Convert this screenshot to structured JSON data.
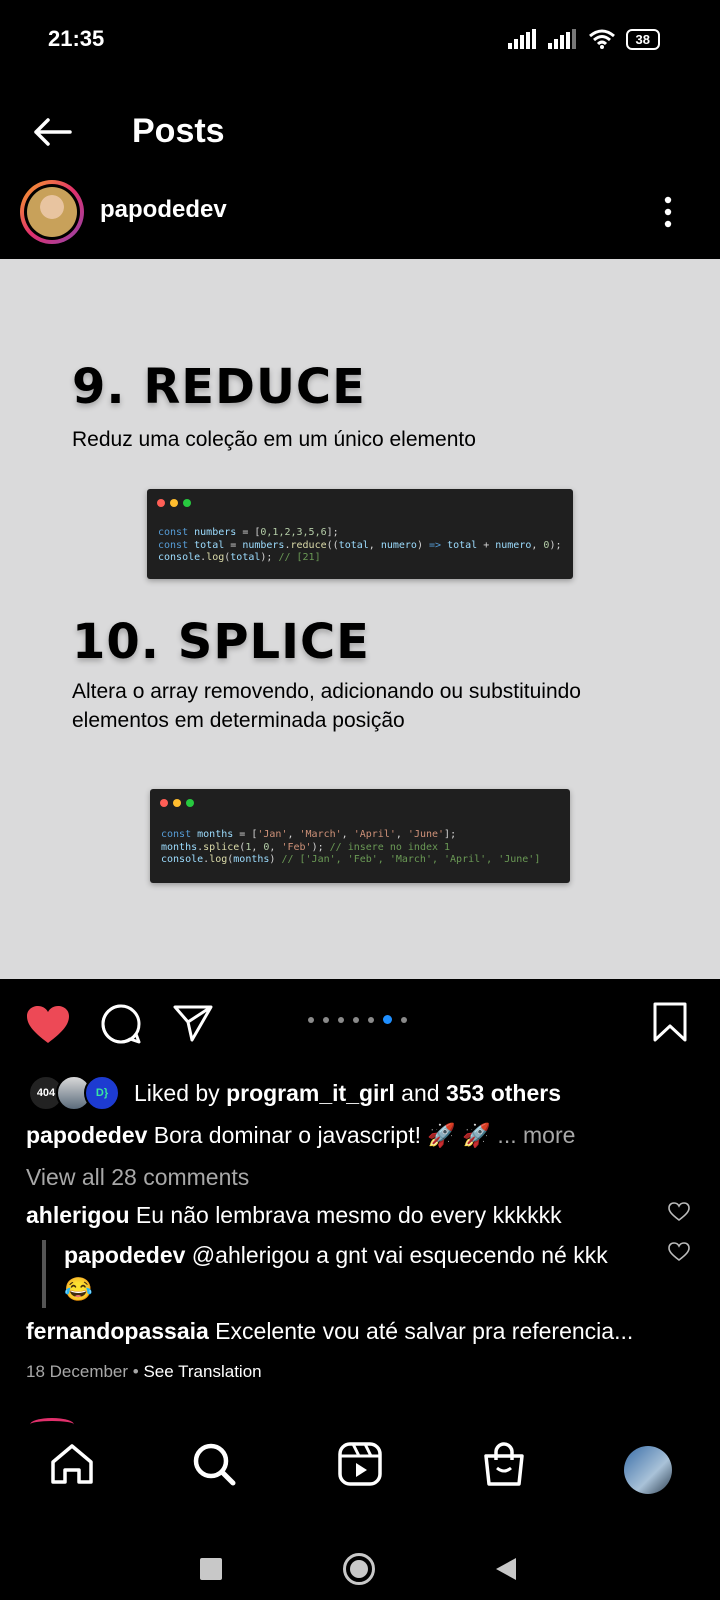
{
  "status_bar": {
    "time": "21:35",
    "battery": "38"
  },
  "header": {
    "title": "Posts"
  },
  "post": {
    "username": "papodedev",
    "slide": {
      "section1_title": "9. REDUCE",
      "section1_desc": "Reduz uma  coleção em um único elemento",
      "code1": [
        "const numbers = [0,1,2,3,5,6];",
        "const total = numbers.reduce((total, numero) => total + numero, 0);",
        "console.log(total); // [21]"
      ],
      "section2_title": "10. SPLICE",
      "section2_desc": "Altera o array removendo, adicionando ou substituindo elementos em determinada posição",
      "code2": [
        "const months = ['Jan', 'March', 'April', 'June'];",
        "months.splice(1, 0, 'Feb'); // insere no index 1",
        "console.log(months) // ['Jan', 'Feb', 'March', 'April', 'June']"
      ]
    },
    "carousel": {
      "count": 7,
      "active_index": 5
    },
    "likes": {
      "avatar1_text": "404",
      "avatar3_text": "D}",
      "prefix": "Liked by ",
      "user": "program_it_girl",
      "middle": " and ",
      "others": "353 others"
    },
    "caption": {
      "user": "papodedev",
      "text": " Bora dominar o javascript! 🚀 🚀",
      "more": " ... more"
    },
    "view_all": "View all 28 comments",
    "comments": [
      {
        "user": "ahlerigou",
        "text": " Eu não lembrava mesmo do every kkkkkk"
      },
      {
        "user": "papodedev",
        "text": " @ahlerigou a gnt vai esquecendo né kkk",
        "emoji": "😂"
      },
      {
        "user": "fernandopassaia",
        "text": " Excelente vou até salvar pra referencia..."
      }
    ],
    "date": "18 December",
    "separator": " • ",
    "translation": "See Translation"
  },
  "colors": {
    "like_red": "#ed4956",
    "carousel_active": "#1f8fff",
    "slide_bg": "#dadadb"
  }
}
